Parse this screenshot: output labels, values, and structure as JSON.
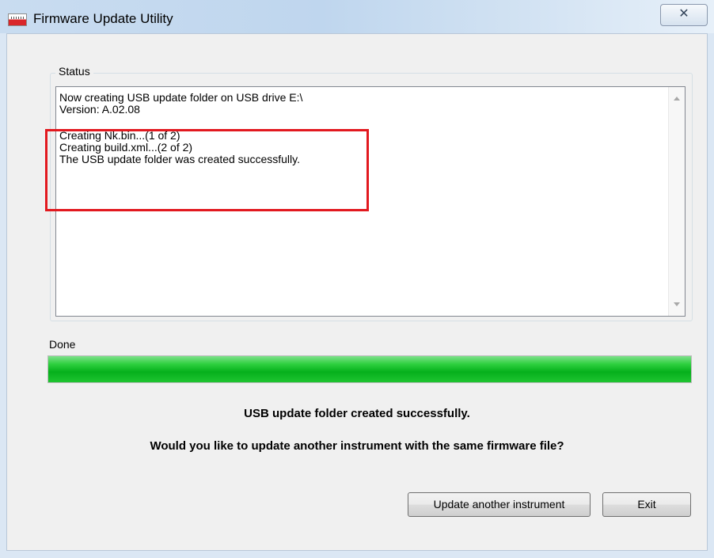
{
  "window": {
    "title": "Firmware Update Utility",
    "close_glyph": "✕"
  },
  "status_group": {
    "label": "Status",
    "log_lines_top": [
      "Now creating USB update folder on USB drive E:\\",
      "Version: A.02.08"
    ],
    "log_lines_bottom": [
      "Creating Nk.bin...(1 of 2)",
      "Creating build.xml...(2 of 2)",
      "The USB update folder was created successfully."
    ]
  },
  "progress": {
    "label": "Done",
    "value_percent": 100,
    "color": "#06b01c"
  },
  "messages": {
    "result": "USB update folder created successfully.",
    "question": "Would you like to update another instrument with the same firmware file?"
  },
  "buttons": {
    "update_another": "Update another instrument",
    "exit": "Exit"
  },
  "colors": {
    "highlight_border": "#e2191f"
  },
  "icons": {
    "app_icon": "instrument-app-icon",
    "close": "close-icon"
  }
}
